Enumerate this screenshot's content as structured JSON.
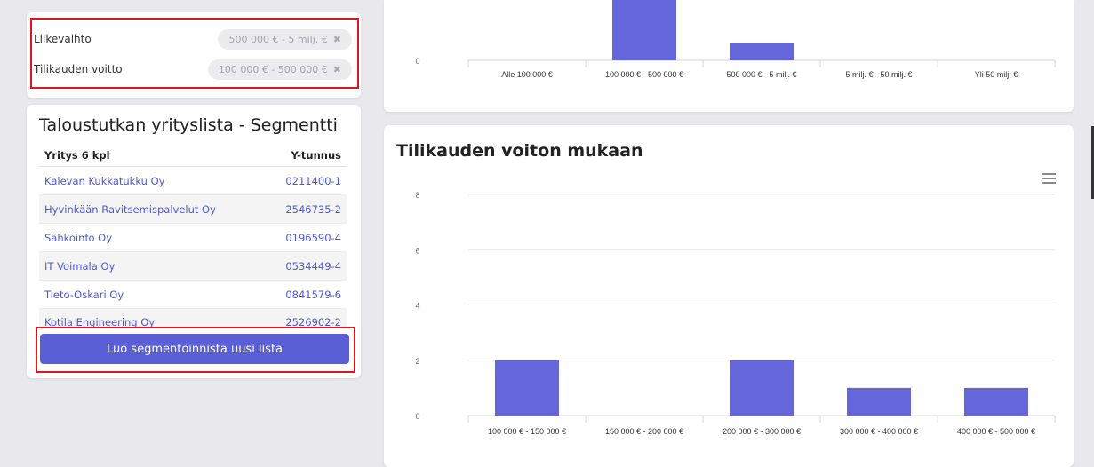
{
  "filters": [
    {
      "label": "Liikevaihto",
      "value": "500 000 € - 5 milj. €"
    },
    {
      "label": "Tilikauden voitto",
      "value": "100 000 € - 500 000 €"
    }
  ],
  "company_list": {
    "title": "Taloustutkan yrityslista - Segmentti",
    "col_company": "Yritys 6 kpl",
    "col_id": "Y-tunnus",
    "rows": [
      {
        "name": "Kalevan Kukkatukku Oy",
        "id": "0211400-1"
      },
      {
        "name": "Hyvinkään Ravitsemispalvelut Oy",
        "id": "2546735-2"
      },
      {
        "name": "Sähköinfo Oy",
        "id": "0196590-4"
      },
      {
        "name": "IT Voimala Oy",
        "id": "0534449-4"
      },
      {
        "name": "Tieto-Oskari Oy",
        "id": "0841579-6"
      },
      {
        "name": "Kotila Engineering Oy",
        "id": "2526902-2"
      }
    ],
    "new_list_button": "Luo segmentoinnista uusi lista"
  },
  "accent_color": "#5b5fd6",
  "main_chart_title": "Tilikauden voiton mukaan",
  "chart_data": [
    {
      "type": "bar",
      "title": "",
      "categories": [
        "Alle 100 000 €",
        "100 000 € - 500 000 €",
        "500 000 € - 5 milj. €",
        "5 milj. € - 50 milj. €",
        "Yli 50 milj. €"
      ],
      "values": [
        0,
        7,
        2,
        0,
        0
      ],
      "y_ticks": [
        "0"
      ],
      "ylim": [
        0,
        8
      ],
      "note": "partially cropped at top",
      "color": "#6466d9"
    },
    {
      "type": "bar",
      "title": "Tilikauden voiton mukaan",
      "categories": [
        "100 000 € - 150 000 €",
        "150 000 € - 200 000 €",
        "200 000 € - 300 000 €",
        "300 000 € - 400 000 €",
        "400 000 € - 500 000 €"
      ],
      "values": [
        2,
        0,
        2,
        1,
        1
      ],
      "y_ticks": [
        "0",
        "2",
        "4",
        "6",
        "8"
      ],
      "ylim": [
        0,
        8
      ],
      "grid": true,
      "color": "#6466d9"
    }
  ]
}
